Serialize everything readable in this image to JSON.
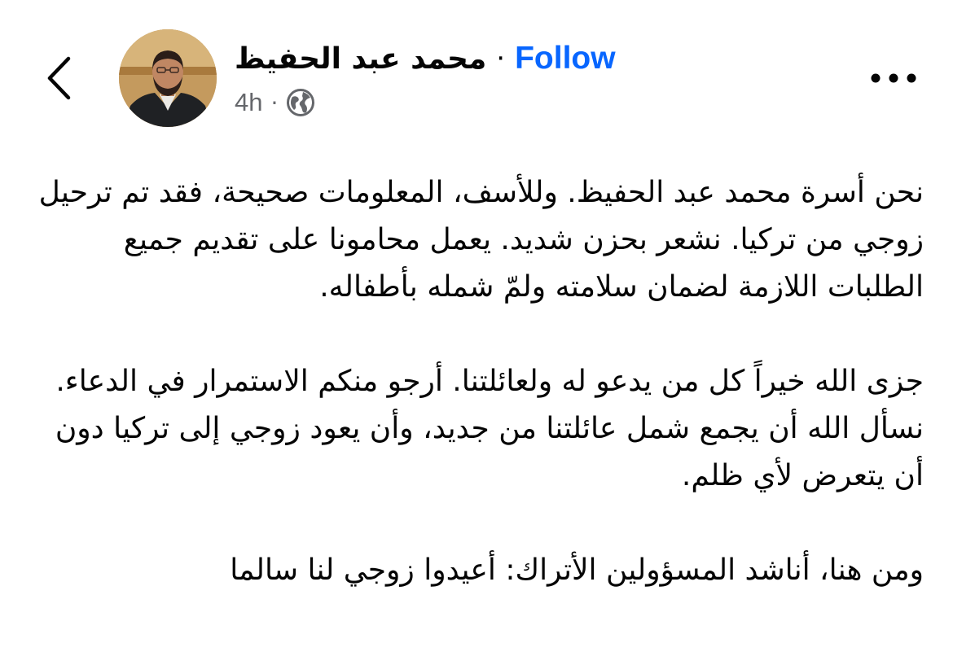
{
  "post": {
    "author_name": "محمد عبد الحفيظ",
    "separator": "·",
    "follow_label": "Follow",
    "timestamp": "4h",
    "meta_separator": "·",
    "audience_icon": "globe-icon",
    "back_icon": "chevron-left-icon",
    "more_icon": "more-options-icon",
    "paragraphs": [
      "نحن أسرة محمد عبد الحفيظ. وللأسف، المعلومات صحيحة، فقد تم ترحيل زوجي من تركيا. نشعر بحزن شديد. يعمل محامونا على تقديم جميع الطلبات اللازمة لضمان سلامته ولمّ شمله بأطفاله.",
      "جزى الله خيراً كل من يدعو له ولعائلتنا. أرجو منكم الاستمرار في الدعاء. نسأل الله أن يجمع شمل عائلتنا من جديد، وأن يعود زوجي إلى تركيا دون أن يتعرض لأي ظلم.",
      "ومن هنا، أناشد المسؤولين الأتراك: أعيدوا زوجي لنا سالما"
    ]
  },
  "colors": {
    "link_blue": "#0866ff",
    "meta_gray": "#65676b",
    "text": "#050505",
    "background": "#ffffff"
  }
}
